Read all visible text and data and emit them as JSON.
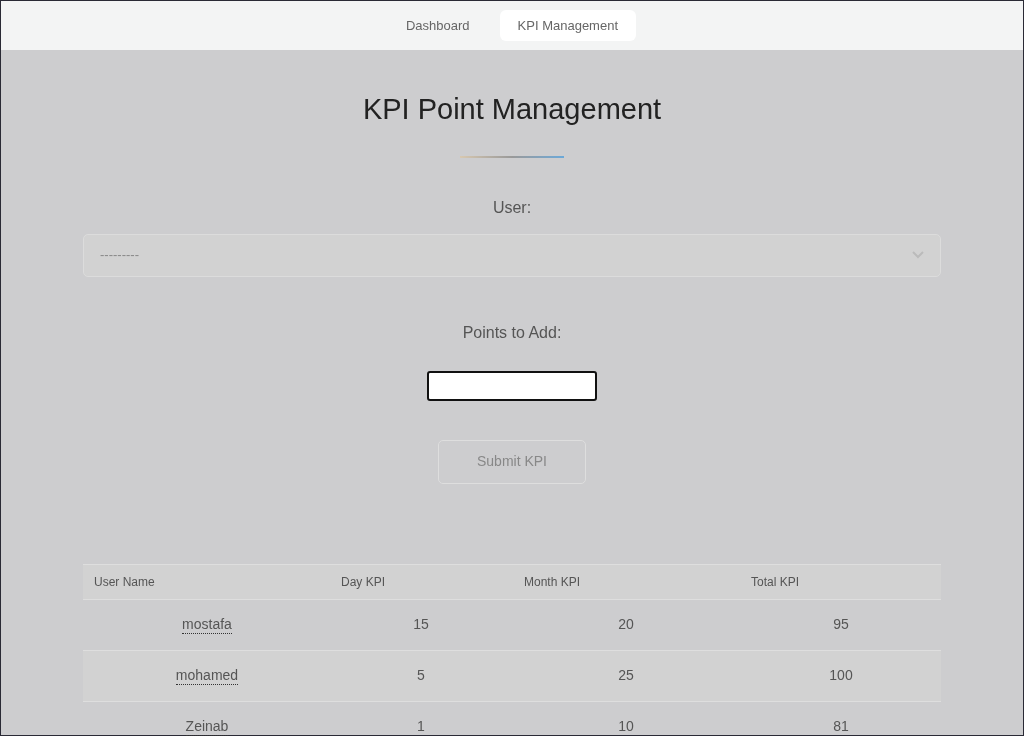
{
  "nav": {
    "tabs": [
      {
        "label": "Dashboard",
        "selected": false
      },
      {
        "label": "KPI Management",
        "selected": true
      }
    ]
  },
  "title": "KPI Point Management",
  "user_field": {
    "label": "User:",
    "value": "---------"
  },
  "points_field": {
    "label": "Points to Add:"
  },
  "submit_button": "Submit KPI",
  "table": {
    "columns": [
      "User Name",
      "Day KPI",
      "Month KPI",
      "Total KPI"
    ],
    "rows": [
      [
        "mostafa",
        "15",
        "20",
        "95"
      ],
      [
        "mohamed",
        "5",
        "25",
        "100"
      ],
      [
        "Zeinab",
        "1",
        "10",
        "81"
      ]
    ]
  }
}
